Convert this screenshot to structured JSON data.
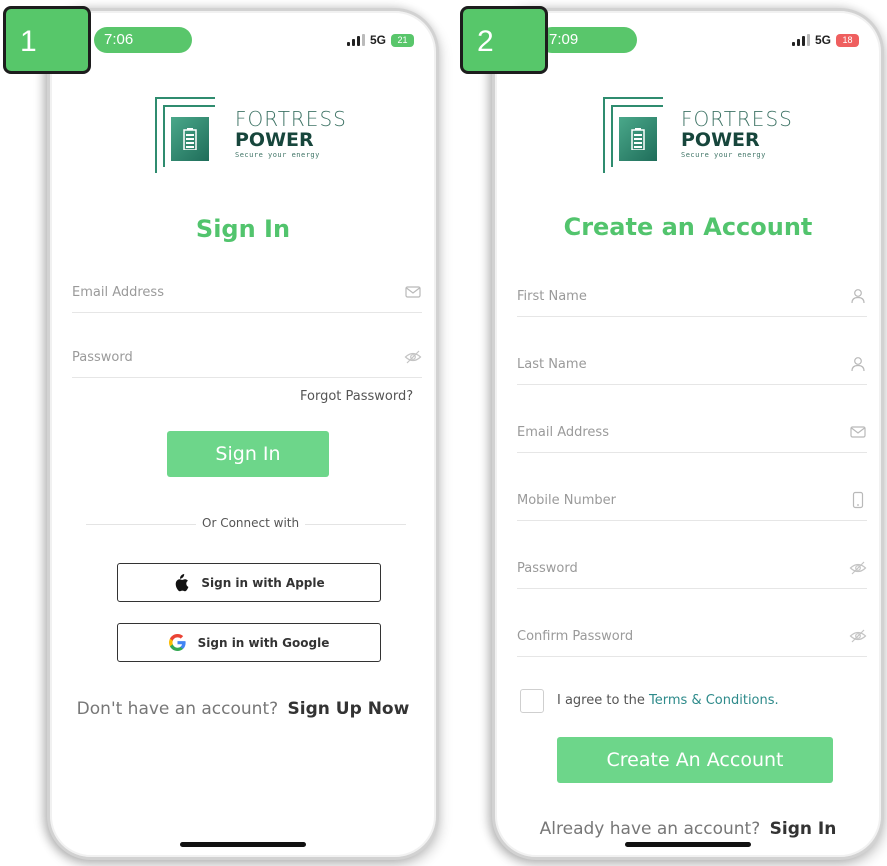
{
  "screens": [
    {
      "step": "1",
      "time": "7:06",
      "network": "5G",
      "battery": "21",
      "logo": {
        "line1": "FORTRESS",
        "line2": "POWER",
        "tagline": "Secure your energy"
      },
      "title": "Sign In",
      "fields": [
        {
          "label": "Email Address",
          "icon": "mail-icon"
        },
        {
          "label": "Password",
          "icon": "eye-off-icon"
        }
      ],
      "forgot_link": "Forgot Password?",
      "submit_label": "Sign In",
      "divider_text": "Or Connect with",
      "social": [
        {
          "label": "Sign in with Apple",
          "icon": "apple-icon"
        },
        {
          "label": "Sign in with Google",
          "icon": "google-icon"
        }
      ],
      "footer_text": "Don't have an account?",
      "footer_link": "Sign Up Now"
    },
    {
      "step": "2",
      "time": "7:09",
      "network": "5G",
      "battery": "18",
      "logo": {
        "line1": "FORTRESS",
        "line2": "POWER",
        "tagline": "Secure your energy"
      },
      "title": "Create an Account",
      "fields": [
        {
          "label": "First Name",
          "icon": "user-icon"
        },
        {
          "label": "Last Name",
          "icon": "user-icon"
        },
        {
          "label": "Email Address",
          "icon": "mail-icon"
        },
        {
          "label": "Mobile Number",
          "icon": "phone-icon"
        },
        {
          "label": "Password",
          "icon": "eye-off-icon"
        },
        {
          "label": "Confirm Password",
          "icon": "eye-off-icon"
        }
      ],
      "agree_text": "I agree to the",
      "terms_link": "Terms & Conditions.",
      "submit_label": "Create An Account",
      "footer_text": "Already have an account?",
      "footer_link": "Sign In"
    }
  ],
  "colors": {
    "accent": "#52c46d",
    "button": "#6dd68a",
    "badge": "#57c76a",
    "terms": "#2d8a8a",
    "battery_low": "#ef5f5f"
  }
}
